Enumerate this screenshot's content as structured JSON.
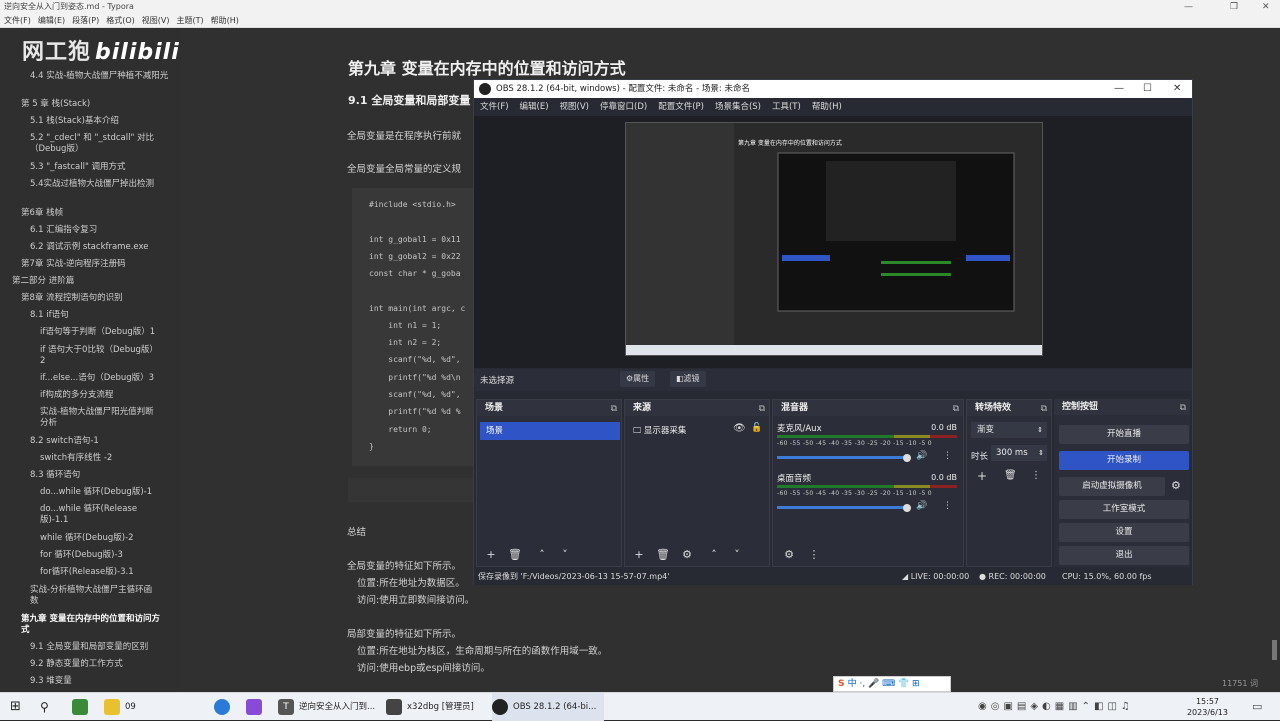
{
  "typora": {
    "title": "逆向安全从入门到姿态.md - Typora",
    "window_controls": [
      "—",
      "❐",
      "✕"
    ],
    "menu": [
      "文件(F)",
      "编辑(E)",
      "段落(P)",
      "格式(O)",
      "视图(V)",
      "主题(T)",
      "帮助(H)"
    ],
    "watermark": "网工狍",
    "watermark_b": "bilibili",
    "toc": [
      "4.4 实战-植物大战僵尸种植不减阳光",
      "第 5 章 栈(Stack)",
      "5.1 栈(Stack)基本介绍",
      "5.2 \"_cdecl\" 和 \"_stdcall\" 对比（Debug版）",
      "5.3 \"_fastcall\" 调用方式",
      "5.4实战过植物大战僵尸掉出检测",
      "第6章 栈帧",
      "6.1 汇编指令复习",
      "6.2 调试示例 stackframe.exe",
      "第7章 实战-逆向程序注册码",
      "第二部分 进阶篇",
      "第8章 流程控制语句的识别",
      "8.1 if语句",
      "if语句等于判断（Debug版）1",
      "if 语句大于0比较（Debug版）2",
      "if...else...语句（Debug版）3",
      "if构成的多分支流程",
      "实战-植物大战僵尸阳光值判断分析",
      "8.2 switch语句-1",
      "switch有序线性 -2",
      "8.3 循环语句",
      "do...while 循环(Debug版)-1",
      "do...while 循环(Release版)-1.1",
      "while 循环(Debug版)-2",
      "for 循环(Debug版)-3",
      "for循环(Release版)-3.1",
      "实战-分析植物大战僵尸主循环函数",
      "第九章 变量在内存中的位置和访问方式",
      "9.1 全局变量和局部变量的区别",
      "9.2 静态变量的工作方式",
      "9.3 堆变量"
    ],
    "sidebar_bottom": [
      "‹",
      "</>"
    ],
    "h1": "第九章 变量在内存中的位置和访问方式",
    "h2": "9.1 全局变量和局部变量",
    "p1": "全局变量是在程序执行前就",
    "p2": "全局变量全局常量的定义规",
    "code": [
      "#include <stdio.h>",
      "",
      "int g_gobal1 = 0x11",
      "int g_gobal2 = 0x22",
      "const char * g_goba",
      "",
      "int main(int argc, c",
      "    int n1 = 1;",
      "    int n2 = 2;",
      "    scanf(\"%d, %d\",",
      "    printf(\"%d %d\\n",
      "    scanf(\"%d, %d\",",
      "    printf(\"%d %d %",
      "    return 0;",
      "}"
    ],
    "summary": "总结",
    "g1": "全局变量的特征如下所示。",
    "g2": "位置:所在地址为数据区。",
    "g3": "访问:使用立即数间接访问。",
    "l1": "局部变量的特征如下所示。",
    "l2": "位置:所在地址为栈区，生命周期与所在的函数作用域一致。",
    "l3": "访问:使用ebp或esp间接访问。",
    "word_count": "11751 词"
  },
  "obs": {
    "title": "OBS 28.1.2 (64-bit, windows) - 配置文件: 未命名 - 场景: 未命名",
    "window_controls": [
      "—",
      "☐",
      "✕"
    ],
    "menu": [
      "文件(F)",
      "编辑(E)",
      "视图(V)",
      "停靠窗口(D)",
      "配置文件(P)",
      "场景集合(S)",
      "工具(T)",
      "帮助(H)"
    ],
    "preview_title": "第九章 变量在内存中的位置和访问方式",
    "no_source": "未选择源",
    "properties": "⚙属性",
    "filters": "◧滤镜",
    "docks": {
      "scenes": "场景",
      "sources": "来源",
      "mixer": "混音器",
      "transitions": "转场特效",
      "controls": "控制按钮"
    },
    "scene_item": "场景",
    "source_item": "显示器采集",
    "mixer": [
      {
        "name": "麦克风/Aux",
        "db": "0.0 dB"
      },
      {
        "name": "桌面音频",
        "db": "0.0 dB"
      }
    ],
    "scale": "-60 -55 -50 -45 -40 -35 -30 -25 -20 -15 -10 -5 0",
    "transition": "渐变",
    "duration_label": "时长",
    "duration": "300 ms",
    "controls": [
      "开始直播",
      "开始录制",
      "启动虚拟摄像机",
      "工作室模式",
      "设置",
      "退出"
    ],
    "status_save": "保存录像到 'F:/Videos/2023-06-13 15-57-07.mp4'",
    "status_live": "LIVE: 00:00:00",
    "status_rec": "REC: 00:00:00",
    "status_cpu": "CPU: 15.0%, 60.00 fps",
    "colors": {
      "accent": "#2f54c6",
      "bg": "#272a33"
    }
  },
  "taskbar": {
    "items": [
      "09",
      "逆向安全从入门到...",
      "x32dbg [管理员]",
      "OBS 28.1.2 (64-bi..."
    ],
    "time": "15:57",
    "date": "2023/6/13",
    "ime": "中 ·, 🎤 ⌨ 👕 ⊞"
  }
}
